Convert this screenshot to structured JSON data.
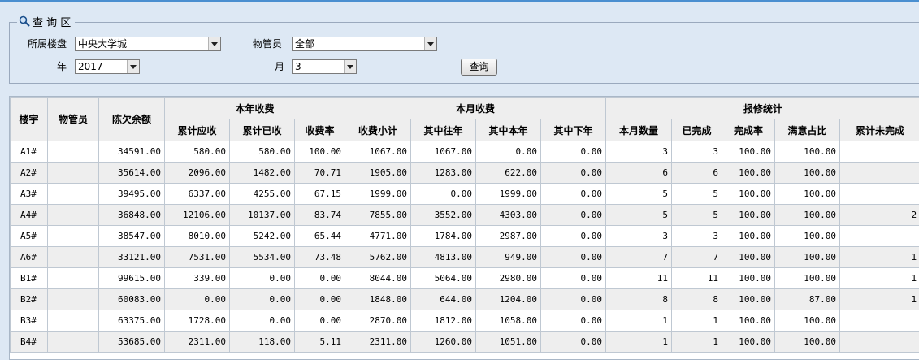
{
  "query": {
    "legend": "查 询 区",
    "building_label": "所属楼盘",
    "building_value": "中央大学城",
    "manager_label": "物管员",
    "manager_value": "全部",
    "year_label": "年",
    "year_value": "2017",
    "month_label": "月",
    "month_value": "3",
    "submit_label": "查询"
  },
  "table": {
    "headers": {
      "building": "楼宇",
      "manager": "物管员",
      "arrears": "陈欠余额",
      "group_year": "本年收费",
      "group_month": "本月收费",
      "group_repair": "报修统计",
      "cols": [
        "累计应收",
        "累计已收",
        "收费率",
        "收费小计",
        "其中往年",
        "其中本年",
        "其中下年",
        "本月数量",
        "已完成",
        "完成率",
        "满意占比",
        "累计未完成"
      ]
    },
    "rows": [
      [
        "A1#",
        "",
        "34591.00",
        "580.00",
        "580.00",
        "100.00",
        "1067.00",
        "1067.00",
        "0.00",
        "0.00",
        "3",
        "3",
        "100.00",
        "100.00",
        ""
      ],
      [
        "A2#",
        "",
        "35614.00",
        "2096.00",
        "1482.00",
        "70.71",
        "1905.00",
        "1283.00",
        "622.00",
        "0.00",
        "6",
        "6",
        "100.00",
        "100.00",
        ""
      ],
      [
        "A3#",
        "",
        "39495.00",
        "6337.00",
        "4255.00",
        "67.15",
        "1999.00",
        "0.00",
        "1999.00",
        "0.00",
        "5",
        "5",
        "100.00",
        "100.00",
        ""
      ],
      [
        "A4#",
        "",
        "36848.00",
        "12106.00",
        "10137.00",
        "83.74",
        "7855.00",
        "3552.00",
        "4303.00",
        "0.00",
        "5",
        "5",
        "100.00",
        "100.00",
        "2"
      ],
      [
        "A5#",
        "",
        "38547.00",
        "8010.00",
        "5242.00",
        "65.44",
        "4771.00",
        "1784.00",
        "2987.00",
        "0.00",
        "3",
        "3",
        "100.00",
        "100.00",
        ""
      ],
      [
        "A6#",
        "",
        "33121.00",
        "7531.00",
        "5534.00",
        "73.48",
        "5762.00",
        "4813.00",
        "949.00",
        "0.00",
        "7",
        "7",
        "100.00",
        "100.00",
        "1"
      ],
      [
        "B1#",
        "",
        "99615.00",
        "339.00",
        "0.00",
        "0.00",
        "8044.00",
        "5064.00",
        "2980.00",
        "0.00",
        "11",
        "11",
        "100.00",
        "100.00",
        "1"
      ],
      [
        "B2#",
        "",
        "60083.00",
        "0.00",
        "0.00",
        "0.00",
        "1848.00",
        "644.00",
        "1204.00",
        "0.00",
        "8",
        "8",
        "100.00",
        "87.00",
        "1"
      ],
      [
        "B3#",
        "",
        "63375.00",
        "1728.00",
        "0.00",
        "0.00",
        "2870.00",
        "1812.00",
        "1058.00",
        "0.00",
        "1",
        "1",
        "100.00",
        "100.00",
        ""
      ],
      [
        "B4#",
        "",
        "53685.00",
        "2311.00",
        "118.00",
        "5.11",
        "2311.00",
        "1260.00",
        "1051.00",
        "0.00",
        "1",
        "1",
        "100.00",
        "100.00",
        ""
      ]
    ]
  }
}
